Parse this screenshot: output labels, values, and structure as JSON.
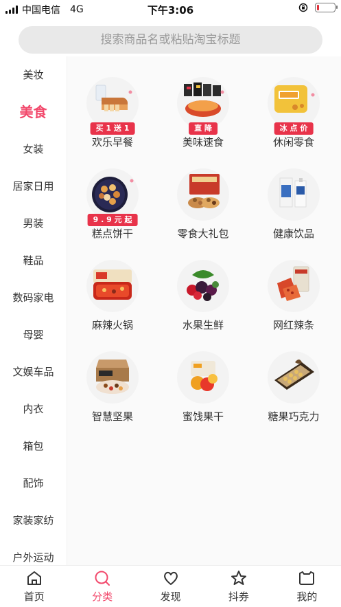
{
  "status": {
    "carrier": "中国电信",
    "network": "4G",
    "time": "下午3:06"
  },
  "search": {
    "placeholder": "搜索商品名或粘贴淘宝标题"
  },
  "sidebar": {
    "items": [
      {
        "label": "美妆"
      },
      {
        "label": "美食"
      },
      {
        "label": "女装"
      },
      {
        "label": "居家日用"
      },
      {
        "label": "男装"
      },
      {
        "label": "鞋品"
      },
      {
        "label": "数码家电"
      },
      {
        "label": "母婴"
      },
      {
        "label": "文娱车品"
      },
      {
        "label": "内衣"
      },
      {
        "label": "箱包"
      },
      {
        "label": "配饰"
      },
      {
        "label": "家装家纺"
      },
      {
        "label": "户外运动"
      }
    ],
    "active_index": 1
  },
  "categories": [
    {
      "label": "欢乐早餐",
      "tag": "买 1 送 1",
      "icon": "bread-icon"
    },
    {
      "label": "美味速食",
      "tag": "直 降",
      "icon": "instant-noodles-icon"
    },
    {
      "label": "休闲零食",
      "tag": "冰 点 价",
      "icon": "snack-bag-icon"
    },
    {
      "label": "糕点饼干",
      "tag": "9 . 9 元 起",
      "icon": "cookie-tin-icon"
    },
    {
      "label": "零食大礼包",
      "tag": "",
      "icon": "gift-box-icon"
    },
    {
      "label": "健康饮品",
      "tag": "",
      "icon": "drink-carton-icon"
    },
    {
      "label": "麻辣火锅",
      "tag": "",
      "icon": "hotpot-icon"
    },
    {
      "label": "水果生鲜",
      "tag": "",
      "icon": "fruit-icon"
    },
    {
      "label": "网红辣条",
      "tag": "",
      "icon": "spicy-strip-icon"
    },
    {
      "label": "智慧坚果",
      "tag": "",
      "icon": "nut-box-icon"
    },
    {
      "label": "蜜饯果干",
      "tag": "",
      "icon": "dried-fruit-icon"
    },
    {
      "label": "糖果巧克力",
      "tag": "",
      "icon": "chocolate-box-icon"
    }
  ],
  "tabbar": {
    "items": [
      {
        "label": "首页",
        "icon": "home-icon"
      },
      {
        "label": "分类",
        "icon": "search-icon"
      },
      {
        "label": "发现",
        "icon": "heart-icon"
      },
      {
        "label": "抖券",
        "icon": "star-icon"
      },
      {
        "label": "我的",
        "icon": "profile-icon"
      }
    ],
    "active_index": 1
  },
  "colors": {
    "accent": "#f2496c",
    "tag": "#e8334a",
    "search_bg": "#e9e9e9"
  }
}
